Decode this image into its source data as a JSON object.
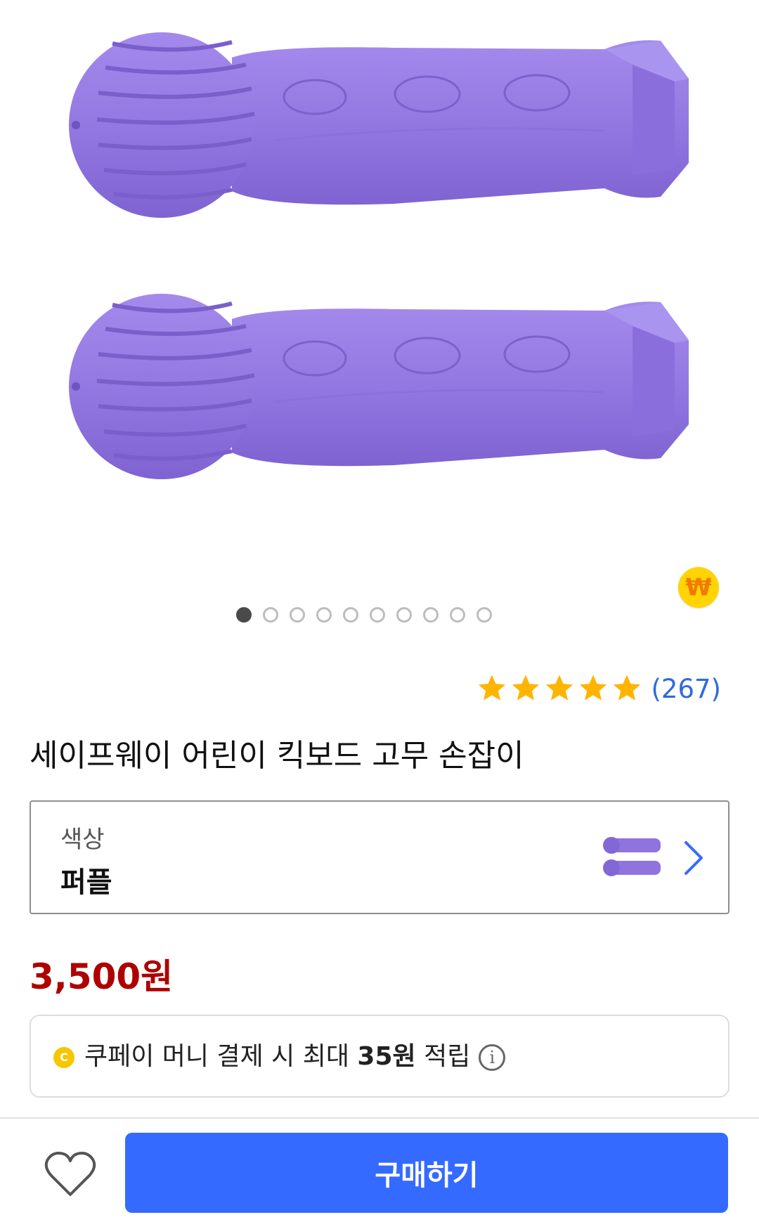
{
  "gallery": {
    "image_name": "purple-rubber-handle-grips",
    "accent_color": "#9b7fe6",
    "current_index": 1,
    "total_images": 10,
    "badge_symbol": "₩"
  },
  "rating": {
    "stars": 5,
    "review_count": "(267)",
    "star_color": "#ffb400"
  },
  "product": {
    "title": "세이프웨이 어린이 킥보드 고무 손잡이",
    "price": "3,500원",
    "price_color": "#ae0000"
  },
  "option": {
    "label": "색상",
    "value": "퍼플"
  },
  "cashback": {
    "prefix": "쿠페이 머니 결제 시 최대 ",
    "amount": "35원",
    "suffix": " 적립",
    "coin_symbol": "C",
    "info_symbol": "i"
  },
  "bottom_bar": {
    "buy_label": "구매하기",
    "buy_color": "#346aff"
  }
}
